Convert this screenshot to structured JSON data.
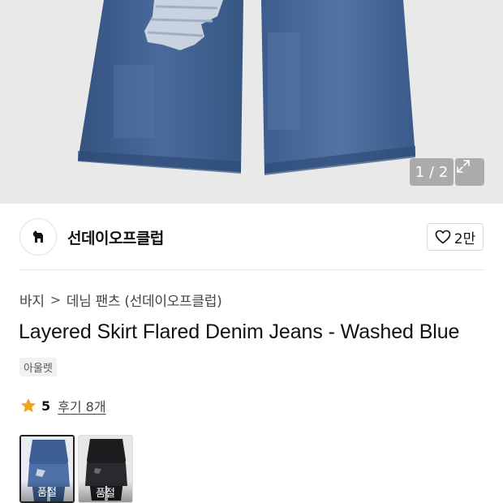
{
  "gallery": {
    "counter": "1 / 2",
    "background": "#e9e9e9",
    "denim_color": "#3f5f92"
  },
  "brand": {
    "name": "선데이오프클럽",
    "like_count": "2만"
  },
  "breadcrumb": {
    "category": "바지",
    "subcategory": "데님 팬츠 (선데이오프클럽)",
    "separator": ">"
  },
  "product": {
    "title": "Layered Skirt Flared Denim Jeans - Washed Blue",
    "tag": "아울렛"
  },
  "rating": {
    "score": "5",
    "reviews_label": "후기 8개",
    "star_color": "#f2a41c"
  },
  "options": [
    {
      "label": "품절",
      "color": "#3d5f93",
      "selected": true
    },
    {
      "label": "품절",
      "color": "#1c1c1f",
      "selected": false
    }
  ],
  "icons": {
    "expand": "expand-icon",
    "heart": "heart-icon",
    "star": "star-icon",
    "brand_logo": "dog-logo-icon"
  }
}
